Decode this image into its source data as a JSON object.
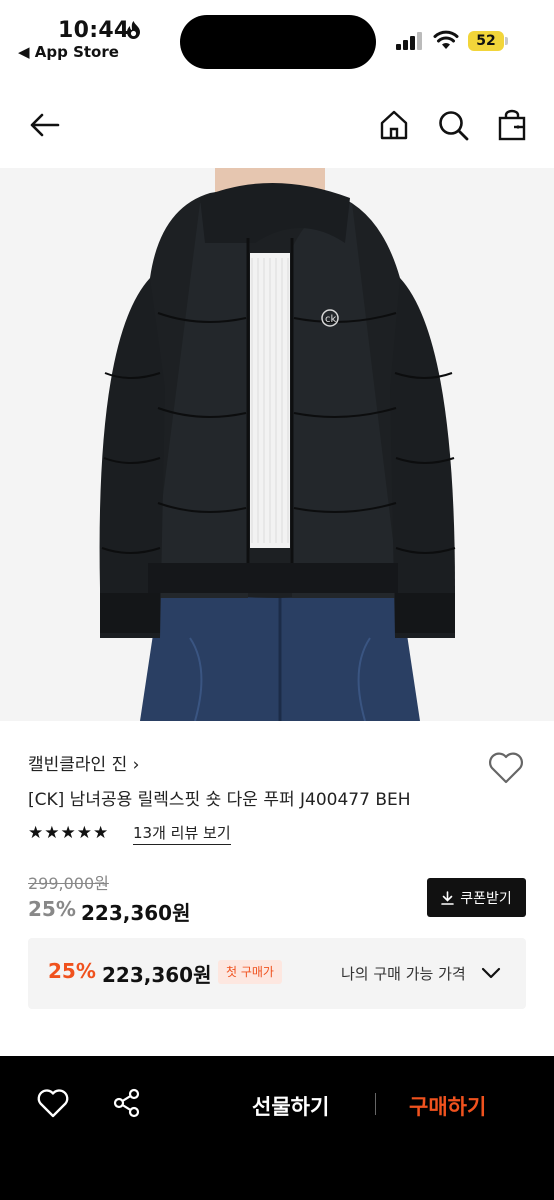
{
  "status_bar": {
    "time": "10:44",
    "back_app": "◀ App Store",
    "battery": "52"
  },
  "header": {
    "icons": [
      "back-arrow-icon",
      "home-icon",
      "search-icon",
      "shopping-bag-icon"
    ]
  },
  "product": {
    "brand": "캘빈클라인 진",
    "brand_chevron": "›",
    "name": "[CK] 남녀공용 릴렉스핏 숏 다운 푸퍼 J400477 BEH",
    "rating_stars": 5,
    "review_link": "13개 리뷰 보기",
    "original_price": "299,000원",
    "discount": "25%",
    "sale_price": "223,360원",
    "coupon_button": "쿠폰받기"
  },
  "price_box": {
    "discount": "25%",
    "price": "223,360원",
    "badge": "첫 구매가",
    "my_price_label": "나의 구매 가능 가격"
  },
  "bottom_bar": {
    "gift_label": "선물하기",
    "buy_label": "구매하기"
  },
  "colors": {
    "accent": "#f0521e",
    "dark": "#000000",
    "battery": "#f2d53a"
  }
}
